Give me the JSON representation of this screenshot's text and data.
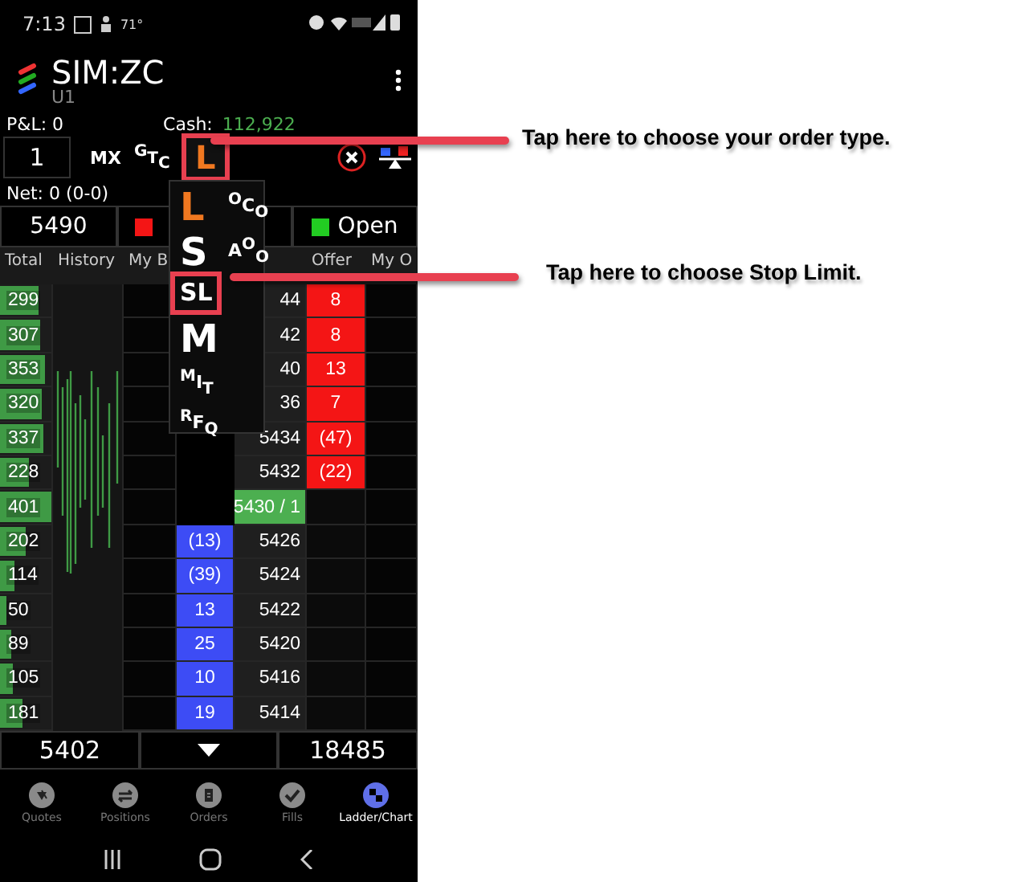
{
  "status_bar": {
    "time": "7:13",
    "temperature": "71°"
  },
  "header": {
    "title": "SIM:ZC",
    "subtitle": "U1"
  },
  "account": {
    "pnl": "P&L: 0",
    "cash_label": "Cash:",
    "cash": "112,922"
  },
  "order_bar": {
    "quantity": "1",
    "mx": "MX",
    "tif": "$^{G}$T$_{C}$",
    "order_type": {
      "label": "L",
      "highlighted": true
    }
  },
  "net": "Net: 0 (0-0)",
  "price_bar": {
    "price": "5490",
    "open": "Open"
  },
  "ladder": {
    "headers": {
      "total": "Total",
      "history": "History",
      "my_bid": "My B",
      "offer": "Offer",
      "my_offer": "My O"
    },
    "rows": [
      {
        "total": "299",
        "level": 0.75,
        "price": "44",
        "offer": "8",
        "last_trade": false
      },
      {
        "total": "307",
        "level": 0.77,
        "price": "42",
        "offer": "8",
        "last_trade": false
      },
      {
        "total": "353",
        "level": 0.88,
        "price": "40",
        "offer": "13",
        "last_trade": false
      },
      {
        "total": "320",
        "level": 0.8,
        "price": "36",
        "offer": "7",
        "last_trade": false
      },
      {
        "total": "337",
        "level": 0.84,
        "price": "5434",
        "offer": "(47)",
        "last_trade": false
      },
      {
        "total": "228",
        "level": 0.57,
        "price": "5432",
        "offer": "(22)",
        "last_trade": false
      },
      {
        "total": "401",
        "level": 1,
        "price": "5430 / 1",
        "last_trade": true
      },
      {
        "total": "202",
        "level": 0.5,
        "bid": "(13)",
        "price": "5426",
        "last_trade": false
      },
      {
        "total": "114",
        "level": 0.28,
        "bid": "(39)",
        "price": "5424",
        "last_trade": false
      },
      {
        "total": "50",
        "level": 0.12,
        "bid": "13",
        "price": "5422",
        "last_trade": false
      },
      {
        "total": "89",
        "level": 0.22,
        "bid": "25",
        "price": "5420",
        "last_trade": false
      },
      {
        "total": "105",
        "level": 0.26,
        "bid": "10",
        "price": "5416",
        "last_trade": false
      },
      {
        "total": "181",
        "level": 0.45,
        "bid": "19",
        "price": "5414",
        "last_trade": false
      }
    ]
  },
  "bottom_bar": {
    "low": "5402",
    "high": "18485"
  },
  "tabs": [
    {
      "label": "Quotes",
      "selected": false
    },
    {
      "label": "Positions",
      "selected": false
    },
    {
      "label": "Orders",
      "selected": false
    },
    {
      "label": "Fills",
      "selected": false
    },
    {
      "label": "Ladder/Chart",
      "selected": true
    }
  ],
  "order_menu": {
    "grid": [
      {
        "label": "L",
        "kind": "big",
        "color": "#f07820"
      },
      {
        "label": "$^{O}$C$_{O}$",
        "kind": "small",
        "color": "#ffffff"
      },
      {
        "label": "S",
        "kind": "big",
        "color": "#ffffff"
      },
      {
        "label": "A$^{O}$$_{O}$",
        "kind": "small",
        "color": "#ffffff"
      }
    ],
    "list": [
      {
        "label": "SL",
        "kind": "medium",
        "highlighted": true
      },
      {
        "label": "M",
        "kind": "big",
        "highlighted": false
      },
      {
        "label": "$^{M}$I$_{T}$",
        "kind": "small",
        "highlighted": false
      },
      {
        "label": "$^{R}$F$_{Q}$",
        "kind": "small",
        "highlighted": false
      }
    ]
  },
  "callouts": [
    {
      "text": "Tap here to choose your order type."
    },
    {
      "text": "Tap here to choose Stop Limit."
    }
  ]
}
